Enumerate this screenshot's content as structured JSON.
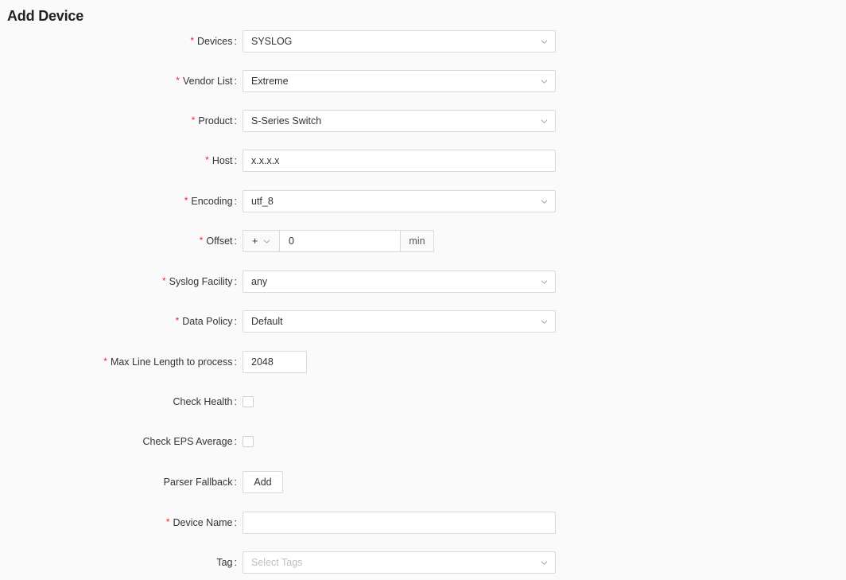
{
  "page": {
    "title": "Add Device"
  },
  "icons": {
    "chevron": "chevron-down-icon",
    "required_color": "#f5222d"
  },
  "form": {
    "devices": {
      "label": "Devices",
      "required": true,
      "value": "SYSLOG"
    },
    "vendor_list": {
      "label": "Vendor List",
      "required": true,
      "value": "Extreme"
    },
    "product": {
      "label": "Product",
      "required": true,
      "value": "S-Series Switch"
    },
    "host": {
      "label": "Host",
      "required": true,
      "value": "x.x.x.x"
    },
    "encoding": {
      "label": "Encoding",
      "required": true,
      "value": "utf_8"
    },
    "offset": {
      "label": "Offset",
      "required": true,
      "sign": "+",
      "value": "0",
      "unit": "min"
    },
    "syslog_facility": {
      "label": "Syslog Facility",
      "required": true,
      "value": "any"
    },
    "data_policy": {
      "label": "Data Policy",
      "required": true,
      "value": "Default"
    },
    "max_line_length": {
      "label": "Max Line Length to process",
      "required": true,
      "value": "2048"
    },
    "check_health": {
      "label": "Check Health",
      "required": false,
      "checked": false
    },
    "check_eps_average": {
      "label": "Check EPS Average",
      "required": false,
      "checked": false
    },
    "parser_fallback": {
      "label": "Parser Fallback",
      "required": false,
      "button_label": "Add"
    },
    "device_name": {
      "label": "Device Name",
      "required": true,
      "value": ""
    },
    "tag": {
      "label": "Tag",
      "required": false,
      "placeholder": "Select Tags"
    }
  }
}
